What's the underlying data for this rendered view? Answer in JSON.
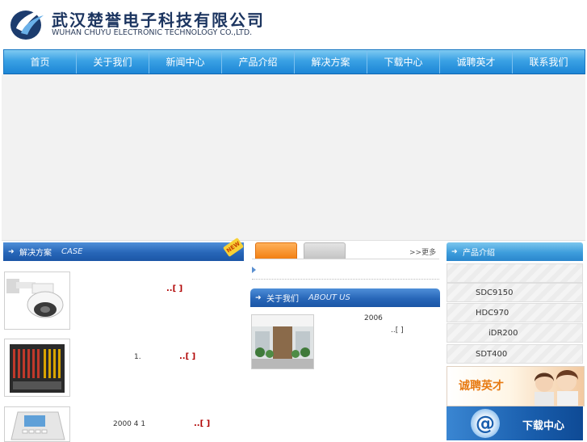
{
  "header": {
    "company_cn": "武汉楚誉电子科技有限公司",
    "company_en": "WUHAN CHUYU ELECTRONIC TECHNOLOGY CO.,LTD."
  },
  "nav": {
    "items": [
      "首页",
      "关于我们",
      "新闻中心",
      "产品介绍",
      "解决方案",
      "下载中心",
      "诚聘英才",
      "联系我们"
    ]
  },
  "case_section": {
    "title": "解决方案",
    "title_en": "CASE",
    "badge": "NEW",
    "items": [
      {
        "text": "",
        "more": "..[  ]"
      },
      {
        "text": "1.",
        "more": "..[  ]"
      },
      {
        "text": "2000 4 1",
        "more": "..[  ]"
      }
    ]
  },
  "news_section": {
    "more_label": ">>更多"
  },
  "about_section": {
    "title": "关于我们",
    "title_en": "ABOUT US",
    "year": "2006",
    "more": "..[ ]"
  },
  "products_section": {
    "title": "产品介绍",
    "items": [
      "",
      "SDC9150",
      "HDC970",
      "iDR200",
      "SDT400"
    ]
  },
  "banners": {
    "join": "诚聘英才",
    "download": "下载中心"
  }
}
